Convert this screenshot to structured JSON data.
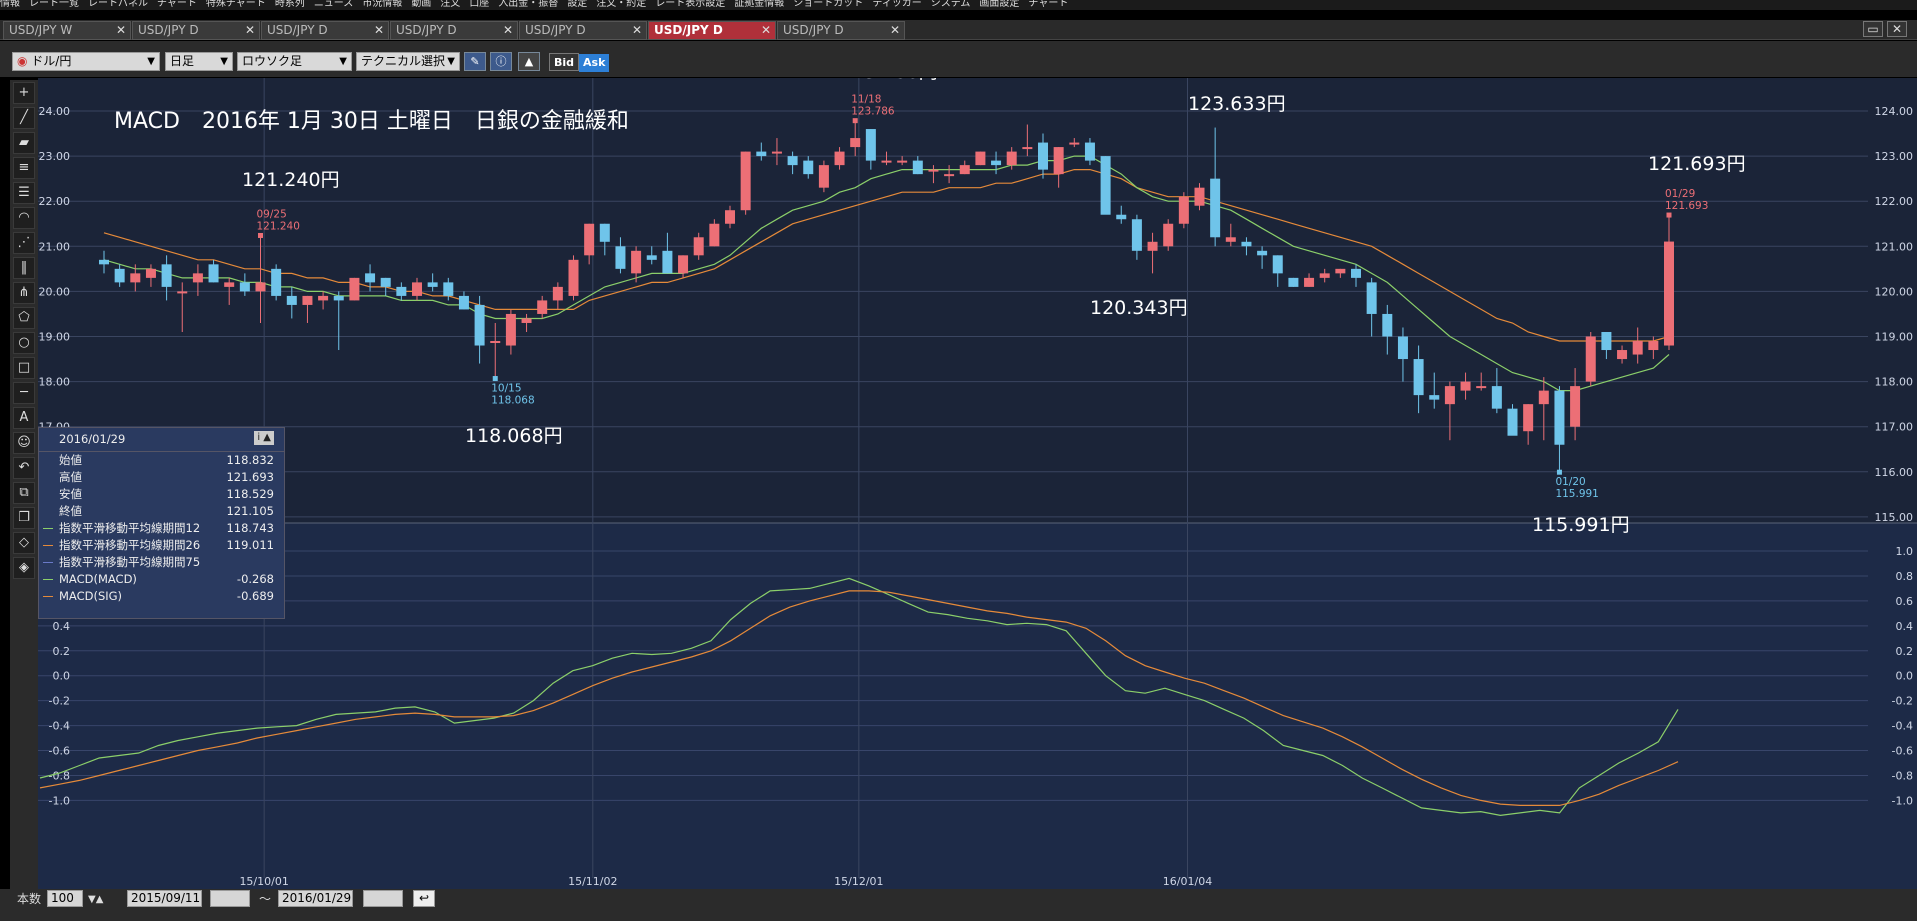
{
  "menubar": {
    "items": [
      "情報",
      "レート一覧",
      "レートパネル",
      "チャート",
      "特殊チャート",
      "時系列",
      "ニュース",
      "市況情報",
      "動画",
      "注文",
      "口座",
      "入出金・振替",
      "設定",
      "注文・約定",
      "レート表示設定",
      "証拠金情報",
      "ショートカット",
      "ティッカー",
      "システム",
      "画面設定",
      "チャート"
    ]
  },
  "tabs": [
    {
      "label": "USD/JPY W"
    },
    {
      "label": "USD/JPY D"
    },
    {
      "label": "USD/JPY D"
    },
    {
      "label": "USD/JPY D"
    },
    {
      "label": "USD/JPY D"
    },
    {
      "label": "USD/JPY D"
    },
    {
      "label": "USD/JPY D"
    }
  ],
  "tab_close": "✕",
  "toolbar": {
    "pair": "ドル/円",
    "period": "日足",
    "chart_type": "ロウソク足",
    "technical": "テクニカル選択",
    "bid": "Bid",
    "ask": "Ask"
  },
  "annotations": {
    "title": "MACD　2016年 1月 30日 土曜日　日銀の金融緩和",
    "a1": "123.786円",
    "a2": "123.633円",
    "a3": "121.240円",
    "a4": "120.343円",
    "a5": "121.693円",
    "a6": "118.068円",
    "a7": "115.991円"
  },
  "chart_data": [
    {
      "type": "candlestick",
      "title": "",
      "y_ticks": [
        "124.00",
        "123.00",
        "122.00",
        "121.00",
        "120.00",
        "119.00",
        "118.00",
        "117.00",
        "116.00",
        "115.00"
      ],
      "x_labels": [
        "15/10/01",
        "15/11/02",
        "15/12/01",
        "16/01/04"
      ],
      "markers": [
        {
          "date": "11/18",
          "value": "123.786"
        },
        {
          "date": "09/25",
          "value": "121.240"
        },
        {
          "date": "10/15",
          "value": "118.068"
        },
        {
          "date": "01/20",
          "value": "115.991"
        },
        {
          "date": "01/29",
          "value": "121.693"
        }
      ],
      "candles": [
        [
          120.7,
          120.9,
          120.4,
          120.6
        ],
        [
          120.5,
          120.6,
          120.1,
          120.2
        ],
        [
          120.2,
          120.6,
          120.0,
          120.4
        ],
        [
          120.3,
          120.6,
          120.1,
          120.5
        ],
        [
          120.6,
          120.8,
          119.8,
          120.1
        ],
        [
          120.0,
          120.2,
          119.1,
          120.0
        ],
        [
          120.2,
          120.6,
          119.9,
          120.4
        ],
        [
          120.6,
          120.7,
          120.2,
          120.2
        ],
        [
          120.1,
          120.3,
          119.7,
          120.2
        ],
        [
          120.2,
          120.4,
          119.9,
          120.0
        ],
        [
          120.0,
          121.24,
          119.3,
          120.2
        ],
        [
          120.5,
          120.6,
          119.8,
          119.9
        ],
        [
          119.9,
          120.1,
          119.4,
          119.7
        ],
        [
          119.7,
          119.9,
          119.3,
          119.9
        ],
        [
          119.8,
          120.0,
          119.6,
          119.9
        ],
        [
          119.9,
          120.0,
          118.7,
          119.8
        ],
        [
          119.8,
          120.3,
          119.8,
          120.3
        ],
        [
          120.4,
          120.6,
          120.0,
          120.2
        ],
        [
          120.3,
          120.3,
          119.9,
          120.1
        ],
        [
          120.1,
          120.2,
          119.8,
          119.9
        ],
        [
          119.9,
          120.3,
          119.8,
          120.2
        ],
        [
          120.2,
          120.4,
          120.0,
          120.1
        ],
        [
          120.2,
          120.3,
          119.8,
          119.9
        ],
        [
          119.9,
          120.0,
          119.6,
          119.6
        ],
        [
          119.7,
          119.9,
          118.4,
          118.8
        ],
        [
          118.9,
          119.3,
          118.068,
          118.9
        ],
        [
          118.8,
          119.6,
          118.6,
          119.5
        ],
        [
          119.3,
          119.5,
          119.1,
          119.4
        ],
        [
          119.5,
          119.9,
          119.4,
          119.8
        ],
        [
          119.8,
          120.2,
          119.6,
          120.1
        ],
        [
          119.9,
          120.8,
          119.8,
          120.7
        ],
        [
          120.8,
          121.5,
          120.6,
          121.5
        ],
        [
          121.5,
          121.5,
          120.8,
          121.1
        ],
        [
          121.0,
          121.2,
          120.4,
          120.5
        ],
        [
          120.4,
          121.0,
          120.2,
          120.9
        ],
        [
          120.8,
          121.0,
          120.6,
          120.7
        ],
        [
          120.9,
          121.3,
          120.4,
          120.4
        ],
        [
          120.4,
          120.8,
          120.3,
          120.8
        ],
        [
          120.8,
          121.3,
          120.7,
          121.2
        ],
        [
          121.0,
          121.6,
          121.0,
          121.5
        ],
        [
          121.5,
          121.9,
          121.4,
          121.8
        ],
        [
          121.8,
          123.1,
          121.7,
          123.1
        ],
        [
          123.1,
          123.3,
          122.9,
          123.0
        ],
        [
          123.1,
          123.4,
          122.8,
          123.1
        ],
        [
          123.0,
          123.1,
          122.6,
          122.8
        ],
        [
          122.9,
          123.0,
          122.5,
          122.6
        ],
        [
          122.3,
          122.9,
          122.2,
          122.8
        ],
        [
          122.8,
          123.2,
          122.7,
          123.1
        ],
        [
          123.2,
          123.786,
          123.0,
          123.4
        ],
        [
          123.6,
          123.6,
          122.7,
          122.9
        ],
        [
          122.9,
          123.1,
          122.8,
          122.9
        ],
        [
          122.9,
          123.0,
          122.8,
          122.9
        ],
        [
          122.9,
          123.0,
          122.6,
          122.6
        ],
        [
          122.7,
          122.8,
          122.4,
          122.7
        ],
        [
          122.6,
          122.8,
          122.4,
          122.6
        ],
        [
          122.6,
          122.9,
          122.6,
          122.8
        ],
        [
          122.8,
          123.1,
          122.8,
          123.1
        ],
        [
          122.9,
          123.1,
          122.6,
          122.8
        ],
        [
          122.8,
          123.2,
          122.7,
          123.1
        ],
        [
          123.2,
          123.7,
          123.0,
          123.2
        ],
        [
          123.3,
          123.5,
          122.5,
          122.7
        ],
        [
          122.6,
          123.2,
          122.3,
          123.2
        ],
        [
          123.3,
          123.4,
          123.2,
          123.3
        ],
        [
          123.3,
          123.4,
          122.8,
          122.9
        ],
        [
          123.0,
          123.0,
          121.8,
          121.7
        ],
        [
          121.7,
          121.9,
          121.5,
          121.6
        ],
        [
          121.6,
          121.7,
          120.7,
          120.9
        ],
        [
          120.9,
          121.3,
          120.4,
          121.1
        ],
        [
          121.0,
          121.6,
          120.9,
          121.5
        ],
        [
          121.5,
          122.2,
          121.4,
          122.1
        ],
        [
          121.9,
          122.4,
          121.8,
          122.3
        ],
        [
          122.5,
          123.633,
          121.0,
          121.2
        ],
        [
          121.1,
          121.5,
          121.0,
          121.2
        ],
        [
          121.1,
          121.2,
          120.8,
          121.0
        ],
        [
          120.9,
          121.0,
          120.5,
          120.8
        ],
        [
          120.8,
          120.8,
          120.1,
          120.4
        ],
        [
          120.3,
          120.3,
          120.1,
          120.1
        ],
        [
          120.1,
          120.4,
          120.1,
          120.3
        ],
        [
          120.3,
          120.5,
          120.2,
          120.4
        ],
        [
          120.4,
          120.5,
          120.3,
          120.5
        ],
        [
          120.5,
          120.6,
          120.1,
          120.3
        ],
        [
          120.2,
          120.3,
          119.0,
          119.5
        ],
        [
          119.5,
          119.7,
          118.6,
          119.0
        ],
        [
          119.0,
          119.2,
          118.0,
          118.5
        ],
        [
          118.5,
          118.8,
          117.3,
          117.7
        ],
        [
          117.7,
          118.2,
          117.4,
          117.6
        ],
        [
          117.5,
          118.0,
          116.7,
          117.9
        ],
        [
          117.8,
          118.2,
          117.6,
          118.0
        ],
        [
          117.9,
          118.2,
          117.8,
          117.9
        ],
        [
          117.9,
          118.3,
          117.3,
          117.4
        ],
        [
          117.4,
          117.5,
          116.9,
          116.8
        ],
        [
          116.9,
          117.5,
          116.6,
          117.5
        ],
        [
          117.5,
          118.1,
          116.7,
          117.8
        ],
        [
          117.8,
          117.9,
          115.991,
          116.6
        ],
        [
          117.0,
          118.3,
          116.7,
          117.9
        ],
        [
          118.0,
          119.1,
          117.9,
          119.0
        ],
        [
          119.1,
          119.1,
          118.5,
          118.7
        ],
        [
          118.5,
          118.8,
          118.4,
          118.7
        ],
        [
          118.6,
          119.2,
          118.4,
          118.9
        ],
        [
          118.7,
          119.0,
          118.5,
          118.9
        ],
        [
          118.8,
          121.693,
          118.7,
          121.105
        ]
      ],
      "ema12": [
        120.7,
        120.6,
        120.5,
        120.5,
        120.4,
        120.3,
        120.3,
        120.3,
        120.3,
        120.2,
        120.2,
        120.1,
        120.1,
        120.0,
        120.0,
        119.9,
        119.9,
        119.9,
        119.9,
        119.8,
        119.8,
        119.8,
        119.7,
        119.7,
        119.5,
        119.4,
        119.4,
        119.4,
        119.4,
        119.5,
        119.7,
        119.9,
        120.1,
        120.2,
        120.3,
        120.4,
        120.4,
        120.4,
        120.5,
        120.6,
        120.8,
        121.1,
        121.4,
        121.6,
        121.8,
        121.9,
        122.0,
        122.2,
        122.3,
        122.5,
        122.6,
        122.7,
        122.7,
        122.7,
        122.7,
        122.7,
        122.7,
        122.7,
        122.8,
        122.8,
        122.9,
        122.9,
        123.0,
        123.0,
        122.8,
        122.6,
        122.3,
        122.1,
        122.0,
        122.0,
        122.0,
        121.9,
        121.8,
        121.6,
        121.4,
        121.2,
        121.0,
        120.9,
        120.8,
        120.7,
        120.6,
        120.4,
        120.2,
        119.9,
        119.6,
        119.3,
        119.0,
        118.8,
        118.6,
        118.4,
        118.2,
        118.1,
        118.0,
        117.8,
        117.8,
        117.9,
        118.0,
        118.1,
        118.2,
        118.3,
        118.6
      ],
      "ema26": [
        121.3,
        121.2,
        121.1,
        121.0,
        120.9,
        120.8,
        120.7,
        120.7,
        120.6,
        120.5,
        120.5,
        120.4,
        120.4,
        120.3,
        120.3,
        120.2,
        120.2,
        120.1,
        120.1,
        120.0,
        120.0,
        119.9,
        119.9,
        119.8,
        119.7,
        119.6,
        119.6,
        119.6,
        119.6,
        119.6,
        119.6,
        119.8,
        119.9,
        120.0,
        120.1,
        120.2,
        120.2,
        120.3,
        120.4,
        120.5,
        120.7,
        120.9,
        121.1,
        121.3,
        121.5,
        121.6,
        121.7,
        121.8,
        121.9,
        122.0,
        122.1,
        122.2,
        122.2,
        122.2,
        122.3,
        122.3,
        122.3,
        122.4,
        122.4,
        122.5,
        122.6,
        122.6,
        122.7,
        122.7,
        122.6,
        122.5,
        122.3,
        122.2,
        122.1,
        122.1,
        122.1,
        122.0,
        121.9,
        121.8,
        121.7,
        121.6,
        121.5,
        121.4,
        121.3,
        121.2,
        121.1,
        121.0,
        120.8,
        120.6,
        120.4,
        120.2,
        120.0,
        119.8,
        119.6,
        119.4,
        119.3,
        119.1,
        119.0,
        118.9,
        118.9,
        118.9,
        118.9,
        118.9,
        118.9,
        118.9,
        119.0
      ]
    },
    {
      "type": "line",
      "title": "",
      "y_ticks": [
        "1.0",
        "0.8",
        "0.6",
        "0.4",
        "0.2",
        "0.0",
        "-0.2",
        "-0.4",
        "-0.6",
        "-0.8",
        "-1.0"
      ],
      "series": [
        {
          "name": "MACD(MACD)",
          "color": "#8bcf6a",
          "values": [
            -0.82,
            -0.78,
            -0.72,
            -0.66,
            -0.64,
            -0.62,
            -0.56,
            -0.52,
            -0.49,
            -0.46,
            -0.44,
            -0.42,
            -0.41,
            -0.4,
            -0.35,
            -0.31,
            -0.3,
            -0.29,
            -0.26,
            -0.25,
            -0.29,
            -0.38,
            -0.36,
            -0.34,
            -0.3,
            -0.2,
            -0.06,
            0.04,
            0.08,
            0.14,
            0.18,
            0.17,
            0.18,
            0.22,
            0.28,
            0.45,
            0.58,
            0.68,
            0.69,
            0.7,
            0.74,
            0.78,
            0.72,
            0.65,
            0.58,
            0.51,
            0.49,
            0.46,
            0.44,
            0.41,
            0.42,
            0.41,
            0.36,
            0.18,
            0.0,
            -0.12,
            -0.14,
            -0.1,
            -0.15,
            -0.2,
            -0.27,
            -0.34,
            -0.44,
            -0.56,
            -0.6,
            -0.64,
            -0.72,
            -0.82,
            -0.9,
            -0.98,
            -1.06,
            -1.08,
            -1.1,
            -1.09,
            -1.12,
            -1.1,
            -1.08,
            -1.1,
            -0.9,
            -0.8,
            -0.7,
            -0.62,
            -0.53,
            -0.27
          ]
        },
        {
          "name": "MACD(SIG)",
          "color": "#e58a3a",
          "values": [
            -0.9,
            -0.87,
            -0.84,
            -0.8,
            -0.76,
            -0.72,
            -0.68,
            -0.64,
            -0.6,
            -0.57,
            -0.54,
            -0.5,
            -0.47,
            -0.44,
            -0.41,
            -0.38,
            -0.35,
            -0.33,
            -0.31,
            -0.3,
            -0.31,
            -0.33,
            -0.33,
            -0.33,
            -0.32,
            -0.28,
            -0.22,
            -0.15,
            -0.08,
            -0.02,
            0.03,
            0.07,
            0.11,
            0.15,
            0.2,
            0.28,
            0.38,
            0.48,
            0.55,
            0.6,
            0.64,
            0.68,
            0.68,
            0.67,
            0.64,
            0.61,
            0.58,
            0.55,
            0.52,
            0.5,
            0.47,
            0.45,
            0.43,
            0.38,
            0.28,
            0.16,
            0.08,
            0.03,
            -0.02,
            -0.06,
            -0.12,
            -0.18,
            -0.25,
            -0.32,
            -0.37,
            -0.42,
            -0.49,
            -0.57,
            -0.66,
            -0.75,
            -0.83,
            -0.9,
            -0.96,
            -1.0,
            -1.03,
            -1.04,
            -1.04,
            -1.04,
            -1.0,
            -0.95,
            -0.88,
            -0.82,
            -0.76,
            -0.69
          ]
        }
      ]
    }
  ],
  "info": {
    "date": "2016/01/29",
    "rows": [
      {
        "label": "始値",
        "value": "118.832"
      },
      {
        "label": "高値",
        "value": "121.693"
      },
      {
        "label": "安値",
        "value": "118.529"
      },
      {
        "label": "終値",
        "value": "121.105"
      },
      {
        "label": "指数平滑移動平均線期間12",
        "value": "118.743"
      },
      {
        "label": "指数平滑移動平均線期間26",
        "value": "119.011"
      },
      {
        "label": "指数平滑移動平均線期間75",
        "value": ""
      },
      {
        "label": "MACD(MACD)",
        "value": "-0.268"
      },
      {
        "label": "MACD(SIG)",
        "value": "-0.689"
      }
    ]
  },
  "bottombar": {
    "count_label": "本数",
    "count": "100",
    "from": "2015/09/11",
    "tilde": "～",
    "to": "2016/01/29"
  }
}
